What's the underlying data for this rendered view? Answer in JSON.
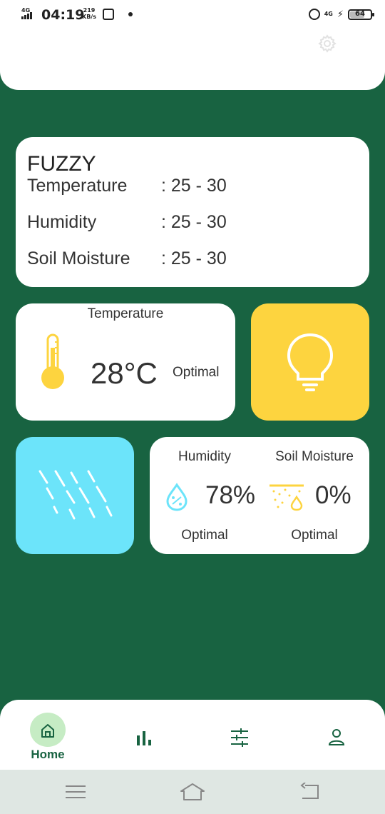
{
  "status_bar": {
    "network": "4G",
    "time": "04:19",
    "speed_value": "219",
    "speed_unit": "KB/s",
    "network_right": "4G",
    "battery": "64"
  },
  "fuzzy": {
    "title": "FUZZY",
    "rows": [
      {
        "label": "Temperature",
        "value": ": 25 - 30"
      },
      {
        "label": "Humidity",
        "value": ": 25 - 30"
      },
      {
        "label": "Soil Moisture",
        "value": ": 25 - 30"
      }
    ]
  },
  "temperature": {
    "heading": "Temperature",
    "value": "28°C",
    "status": "Optimal"
  },
  "humidity": {
    "heading": "Humidity",
    "value": "78%",
    "status": "Optimal"
  },
  "soil": {
    "heading": "Soil Moisture",
    "value": "0%",
    "status": "Optimal"
  },
  "bottom_nav": {
    "home_label": "Home"
  },
  "colors": {
    "background": "#186341",
    "accent_yellow": "#fdd43f",
    "accent_cyan": "#6ce4fa",
    "home_highlight": "#c6ecc4"
  },
  "icons": [
    "settings-gear-icon",
    "thermometer-icon",
    "lightbulb-icon",
    "rain-icon",
    "humidity-drop-icon",
    "soil-moisture-icon",
    "home-icon",
    "chart-icon",
    "sliders-icon",
    "profile-icon",
    "menu-icon",
    "home-outline-icon",
    "back-icon"
  ]
}
